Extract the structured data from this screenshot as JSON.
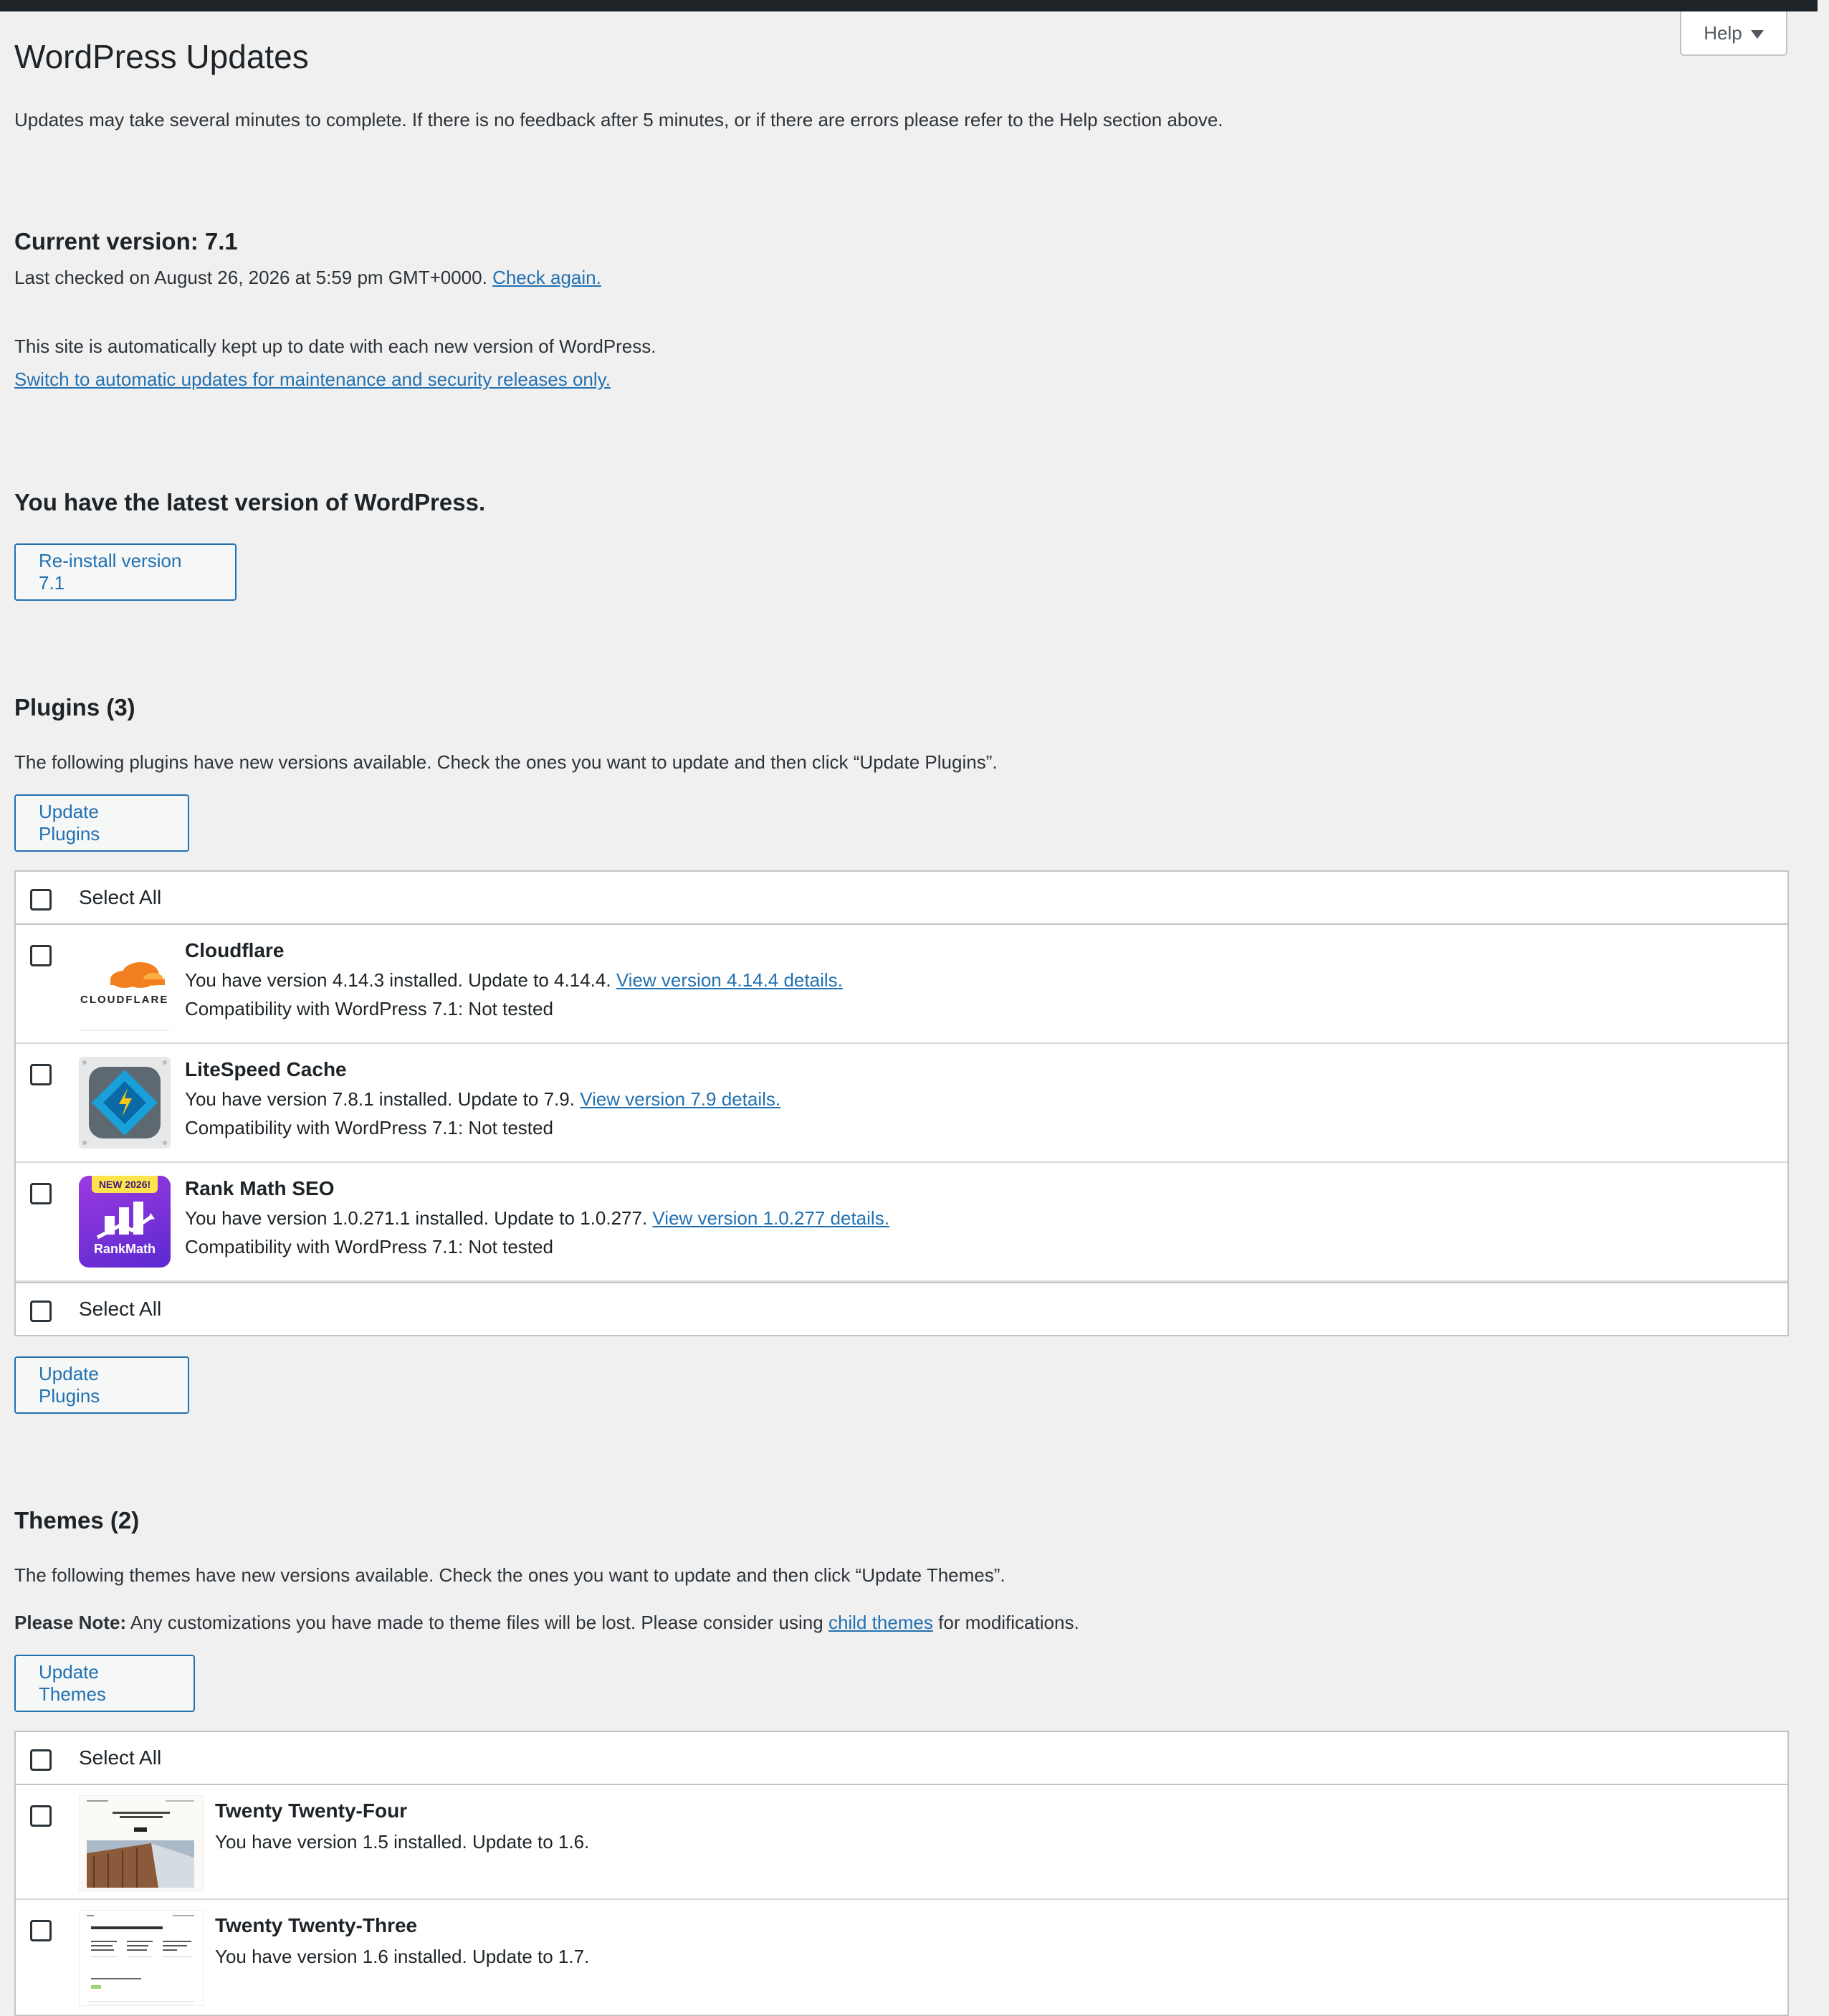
{
  "help": {
    "label": "Help"
  },
  "page": {
    "title": "WordPress Updates",
    "intro": "Updates may take several minutes to complete. If there is no feedback after 5 minutes, or if there are errors please refer to the Help section above."
  },
  "core": {
    "current_version": "Current version: 7.1",
    "last_checked": "Last checked on August 26, 2026 at 5:59 pm GMT+0000.",
    "check_again": "Check again.",
    "auto_notice": "This site is automatically kept up to date with each new version of WordPress.",
    "switch_link": "Switch to automatic updates for maintenance and security releases only.",
    "latest_heading": "You have the latest version of WordPress.",
    "reinstall_label": "Re-install version 7.1"
  },
  "plugins": {
    "heading": "Plugins (3)",
    "description": "The following plugins have new versions available. Check the ones you want to update and then click “Update Plugins”.",
    "update_label": "Update Plugins",
    "select_all": "Select All",
    "items": [
      {
        "name": "Cloudflare",
        "status": "You have version 4.14.3 installed. Update to 4.14.4.",
        "details_link": "View version 4.14.4 details.",
        "compat": "Compatibility with WordPress 7.1: Not tested",
        "icon": "cloudflare-logo",
        "logo_text": "CLOUDFLARE"
      },
      {
        "name": "LiteSpeed Cache",
        "status": "You have version 7.8.1 installed. Update to 7.9.",
        "details_link": "View version 7.9 details.",
        "compat": "Compatibility with WordPress 7.1: Not tested",
        "icon": "litespeed-logo"
      },
      {
        "name": "Rank Math SEO",
        "status": "You have version 1.0.271.1 installed. Update to 1.0.277.",
        "details_link": "View version 1.0.277 details.",
        "compat": "Compatibility with WordPress 7.1: Not tested",
        "icon": "rankmath-logo",
        "badge": "NEW 2026!",
        "logo_text": "RankMath"
      }
    ]
  },
  "themes": {
    "heading": "Themes (2)",
    "description": "The following themes have new versions available. Check the ones you want to update and then click “Update Themes”.",
    "note_label": "Please Note:",
    "note_text": "Any customizations you have made to theme files will be lost. Please consider using",
    "child_themes_link": "child themes",
    "note_suffix": "for modifications.",
    "update_label": "Update Themes",
    "select_all": "Select All",
    "items": [
      {
        "name": "Twenty Twenty-Four",
        "status": "You have version 1.5 installed. Update to 1.6."
      },
      {
        "name": "Twenty Twenty-Three",
        "status": "You have version 1.6 installed. Update to 1.7."
      }
    ]
  },
  "colors": {
    "accent": "#2271b1",
    "topbar": "#1d2327",
    "background": "#f0f0f1"
  }
}
